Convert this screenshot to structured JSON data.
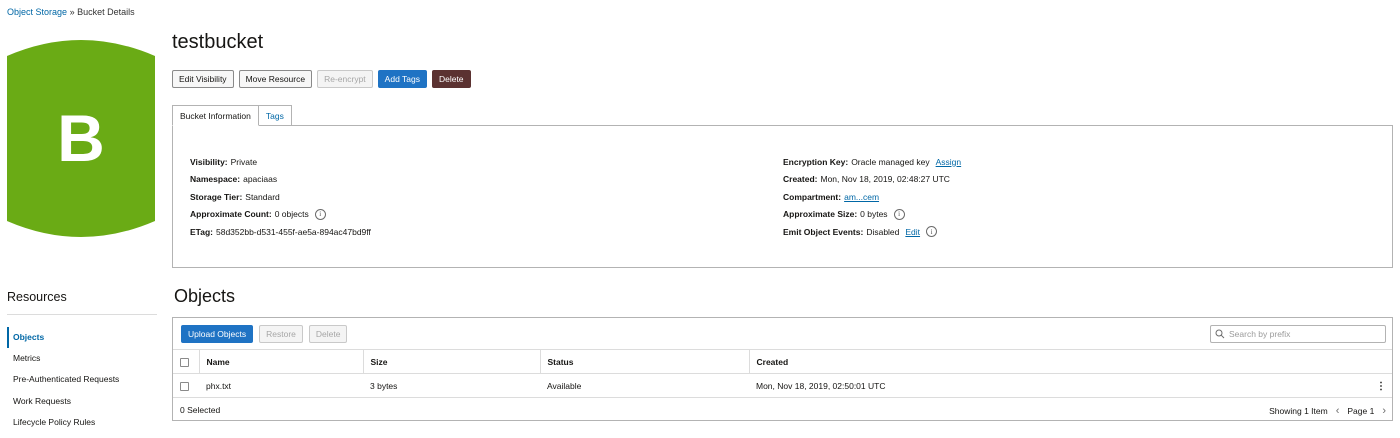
{
  "breadcrumb": {
    "parent": "Object Storage",
    "separator": "»",
    "current": "Bucket Details"
  },
  "bucket": {
    "initial": "B",
    "name": "testbucket",
    "icon_color": "#6aab15"
  },
  "actions": {
    "edit_visibility": "Edit Visibility",
    "move_resource": "Move Resource",
    "re_encrypt": "Re-encrypt",
    "add_tags": "Add Tags",
    "delete": "Delete"
  },
  "tabs": {
    "bucket_information": "Bucket Information",
    "tags": "Tags"
  },
  "info": {
    "visibility": {
      "label": "Visibility:",
      "value": "Private"
    },
    "namespace": {
      "label": "Namespace:",
      "value": "apaciaas"
    },
    "storage_tier": {
      "label": "Storage Tier:",
      "value": "Standard"
    },
    "approximate_count": {
      "label": "Approximate Count:",
      "value": "0 objects"
    },
    "etag": {
      "label": "ETag:",
      "value": "58d352bb-d531-455f-ae5a-894ac47bd9ff"
    },
    "encryption_key": {
      "label": "Encryption Key:",
      "value": "Oracle managed key",
      "link": "Assign"
    },
    "created": {
      "label": "Created:",
      "value": "Mon, Nov 18, 2019, 02:48:27 UTC"
    },
    "compartment": {
      "label": "Compartment:",
      "value": "am...cem"
    },
    "approximate_size": {
      "label": "Approximate Size:",
      "value": "0 bytes"
    },
    "emit_object_events": {
      "label": "Emit Object Events:",
      "value": "Disabled",
      "link": "Edit"
    }
  },
  "resources": {
    "title": "Resources",
    "items": [
      "Objects",
      "Metrics",
      "Pre-Authenticated Requests",
      "Work Requests",
      "Lifecycle Policy Rules"
    ]
  },
  "objects": {
    "title": "Objects",
    "upload": "Upload Objects",
    "restore": "Restore",
    "delete": "Delete",
    "search_placeholder": "Search by prefix",
    "columns": {
      "name": "Name",
      "size": "Size",
      "status": "Status",
      "created": "Created"
    },
    "rows": [
      {
        "name": "phx.txt",
        "size": "3 bytes",
        "status": "Available",
        "created": "Mon, Nov 18, 2019, 02:50:01 UTC"
      }
    ],
    "selected": "0 Selected",
    "showing": "Showing 1 Item",
    "page": "Page 1"
  },
  "colors": {
    "primary": "#1f73c4",
    "danger": "#5b3231",
    "link": "#0067a6",
    "bucket": "#6aab15"
  }
}
